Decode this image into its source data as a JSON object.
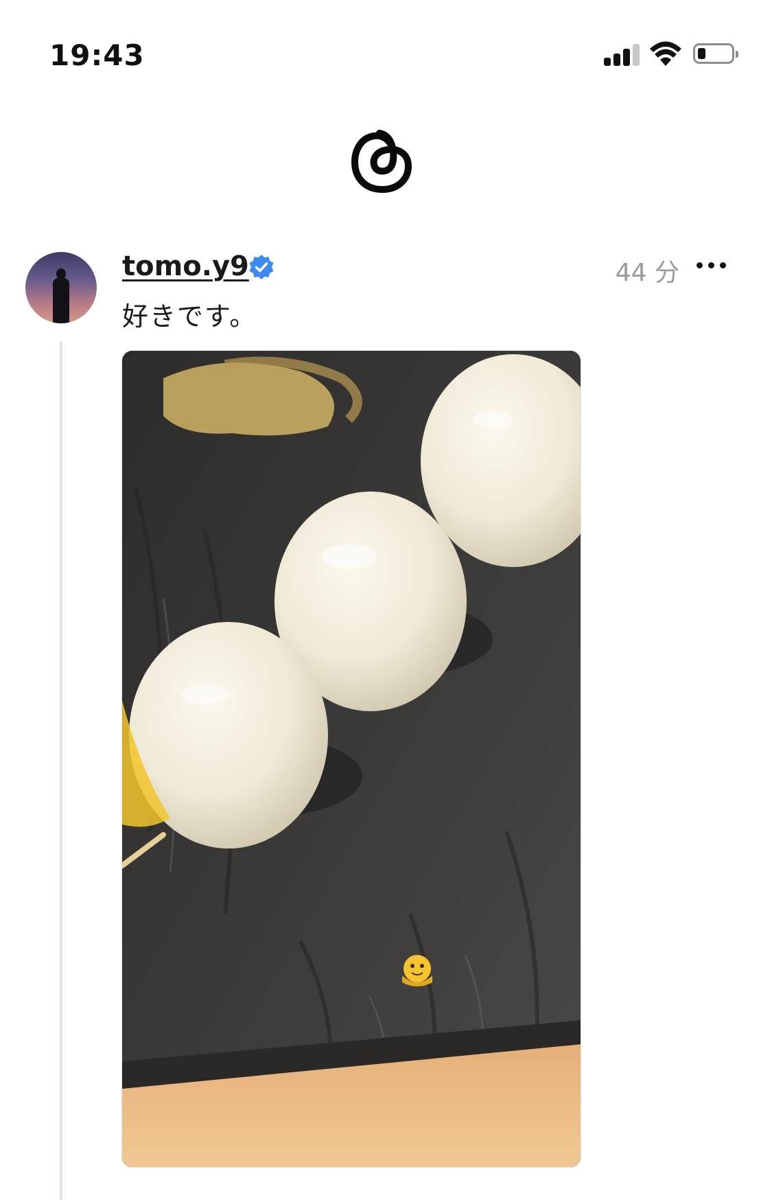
{
  "status_bar": {
    "time": "19:43",
    "signal_bars": 3,
    "signal_bars_total": 4,
    "battery_level": 0.2
  },
  "header": {
    "logo_icon": "threads-logo-icon"
  },
  "post": {
    "username": "tomo.y9",
    "verified": true,
    "verified_color": "#3d8af7",
    "timestamp": "44 分",
    "text": "好きです。",
    "more_icon": "more-horizontal-icon",
    "image_description_icon": "photo",
    "emoji_sticker": "melting-face-icon"
  }
}
